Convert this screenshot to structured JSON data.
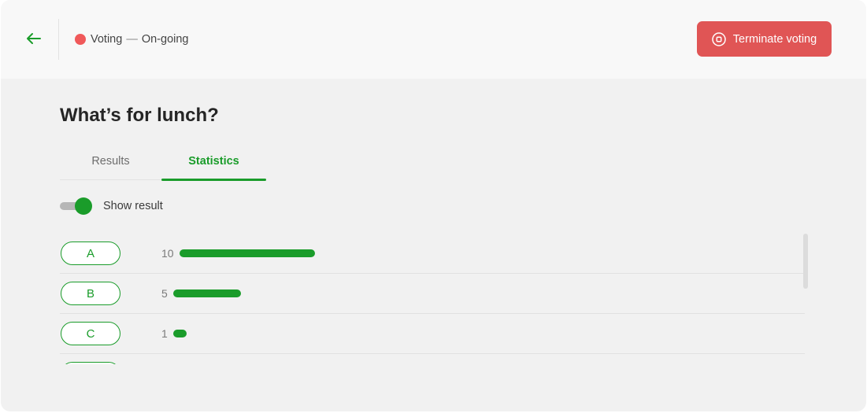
{
  "header": {
    "status_text": "Voting",
    "status_separator": "—",
    "status_value": "On-going",
    "status_color": "#f0595a",
    "terminate_label": "Terminate voting",
    "terminate_color": "#e05555"
  },
  "poll": {
    "title": "What’s for lunch?"
  },
  "tabs": [
    {
      "label": "Results",
      "active": false
    },
    {
      "label": "Statistics",
      "active": true
    }
  ],
  "toggle": {
    "label": "Show result",
    "on": true
  },
  "accent_color": "#1a9c2a",
  "options": [
    {
      "label": "A",
      "count": 10
    },
    {
      "label": "B",
      "count": 5
    },
    {
      "label": "C",
      "count": 1
    }
  ]
}
